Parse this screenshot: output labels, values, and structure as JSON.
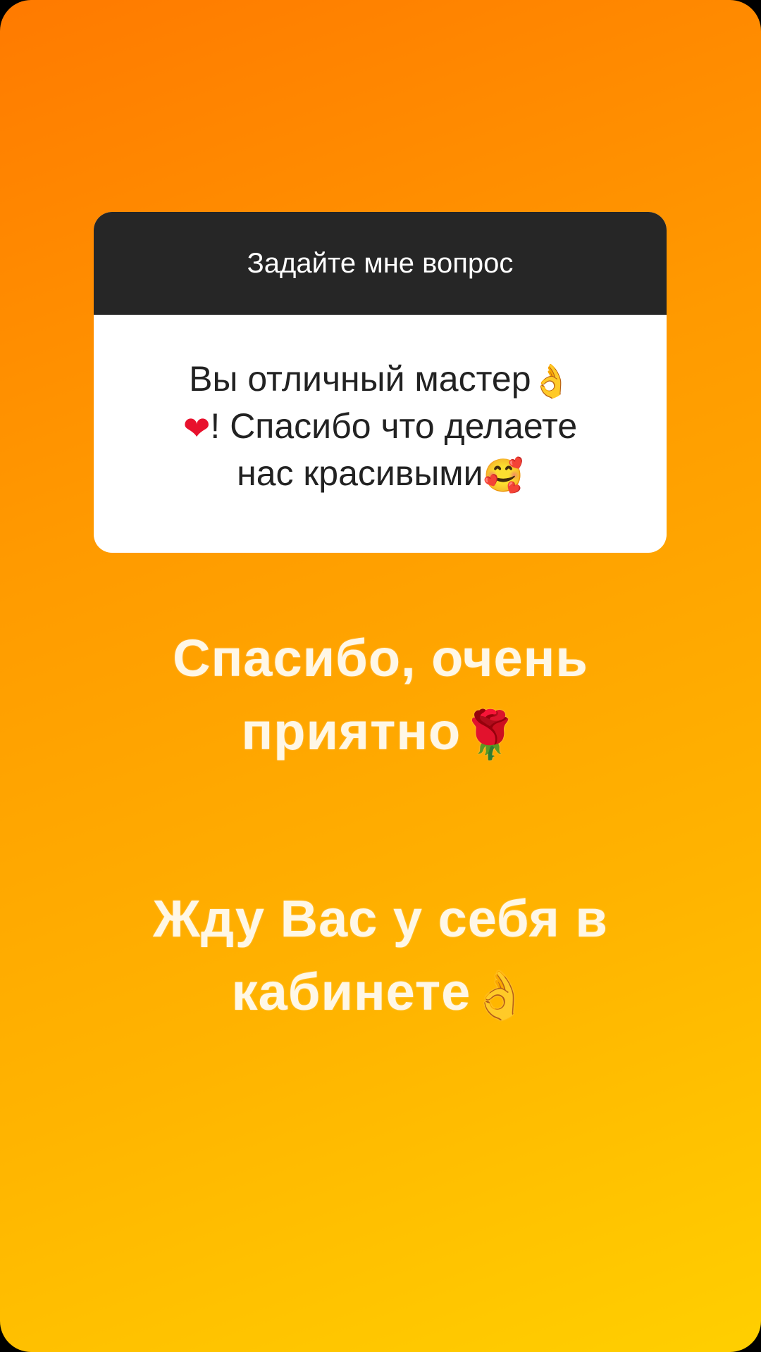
{
  "question_box": {
    "header": "Задайте мне вопрос",
    "answer_line1": "Вы отличный мастер",
    "answer_line2": "! Спасибо что делаете",
    "answer_line3": "нас красивыми"
  },
  "reply1": {
    "line1": "Спасибо, очень",
    "line2": "приятно"
  },
  "reply2": {
    "line1": "Жду Вас у себя в",
    "line2": "кабинете"
  },
  "icons": {
    "ok_hand": "ok-hand-icon",
    "red_heart": "red-heart-icon",
    "smiling_face_with_hearts": "smiling-face-with-hearts-icon",
    "rose": "rose-icon"
  },
  "colors": {
    "gradient_start": "#ff7a00",
    "gradient_end": "#ffcf00",
    "card_header": "#262626",
    "card_body": "#ffffff"
  }
}
